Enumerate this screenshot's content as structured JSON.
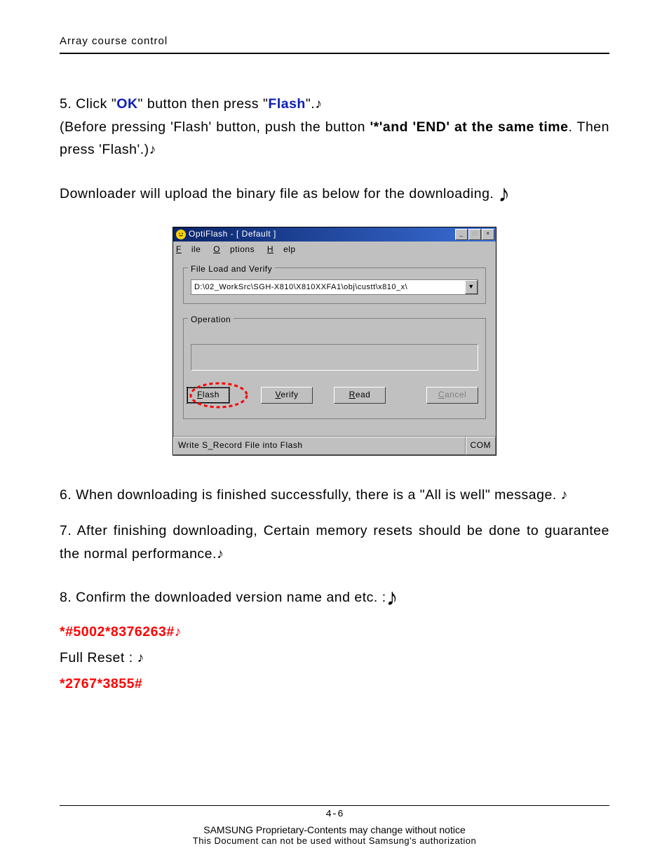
{
  "header": {
    "title": "Array course control"
  },
  "step5": {
    "prefix": "5. Click \"",
    "ok": "OK",
    "mid1": "\" button then press \"",
    "flash": "Flash",
    "suffix": "\".",
    "note": "♪",
    "line2a": "(Before pressing 'Flash' button, push the button ",
    "line2b": "'*'and 'END' at the same time",
    "line2c": ". Then press 'Flash'.)",
    "line3": "Downloader will upload the binary file as below for the downloading. "
  },
  "app": {
    "title": "OptiFlash - [ Default ]",
    "menu": {
      "file": "File",
      "options": "Options",
      "help": "Help",
      "file_u": "F",
      "options_u": "O",
      "help_u": "H"
    },
    "group1": {
      "legend": "File Load and Verify",
      "path": "D:\\02_WorkSrc\\SGH-X810\\X810XXFA1\\obj\\custt\\x810_x\\"
    },
    "group2": {
      "legend": "Operation"
    },
    "buttons": {
      "flash": "Flash",
      "verify": "Verify",
      "read": "Read",
      "cancel": "Cancel",
      "flash_u": "F",
      "verify_u": "V",
      "read_u": "R",
      "cancel_u": "C"
    },
    "status": {
      "left": "Write S_Record File into Flash",
      "right": "COM"
    },
    "win": {
      "min": "_",
      "max": "□",
      "close": "×"
    }
  },
  "step6": {
    "text": "6. When downloading is finished successfully, there is a \"All is well\" message. ",
    "note": "♪"
  },
  "step7": {
    "text": "7. After finishing downloading, Certain memory resets should be done to guarantee the normal performance.",
    "note": "♪"
  },
  "step8": {
    "line1": "8. Confirm the downloaded version name and etc. :",
    "code1": "*#5002*8376263#",
    "code1_note": "♪",
    "line2": "Full Reset : ",
    "line2_note": "♪",
    "code2": "*2767*3855#"
  },
  "footer": {
    "page_no": "4-6",
    "line1": "SAMSUNG Proprietary-Contents may change without notice",
    "line2": "This Document can not be used without Samsung's authorization"
  }
}
